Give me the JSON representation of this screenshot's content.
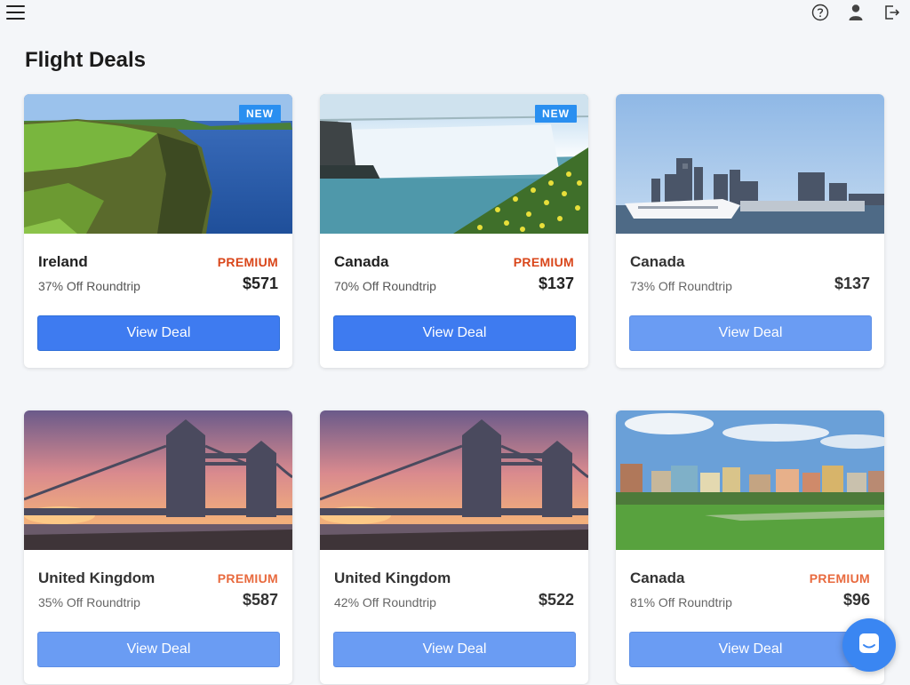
{
  "header": {
    "menu_icon": "hamburger-menu-icon",
    "icons": [
      "help-circle-icon",
      "user-icon",
      "logout-icon"
    ]
  },
  "page": {
    "title": "Flight Deals"
  },
  "colors": {
    "primary_button": "#3e7bf0",
    "premium": "#e35b2b",
    "new_badge": "#2a8ff0"
  },
  "deals": [
    {
      "destination": "Ireland",
      "premium": "PREMIUM",
      "discount": "37% Off Roundtrip",
      "price": "$571",
      "button": "View Deal",
      "badge": "NEW",
      "image": "cliffs-coast-photo"
    },
    {
      "destination": "Canada",
      "premium": "PREMIUM",
      "discount": "70% Off Roundtrip",
      "price": "$137",
      "button": "View Deal",
      "badge": "NEW",
      "image": "waterfall-photo"
    },
    {
      "destination": "Canada",
      "premium": "",
      "discount": "73% Off Roundtrip",
      "price": "$137",
      "button": "View Deal",
      "badge": "",
      "image": "harbor-city-photo"
    },
    {
      "destination": "United Kingdom",
      "premium": "PREMIUM",
      "discount": "35% Off Roundtrip",
      "price": "$587",
      "button": "View Deal",
      "badge": "",
      "image": "tower-bridge-photo"
    },
    {
      "destination": "United Kingdom",
      "premium": "",
      "discount": "42% Off Roundtrip",
      "price": "$522",
      "button": "View Deal",
      "badge": "",
      "image": "tower-bridge-photo"
    },
    {
      "destination": "Canada",
      "premium": "PREMIUM",
      "discount": "81% Off Roundtrip",
      "price": "$96",
      "button": "View Deal",
      "badge": "",
      "image": "city-park-photo"
    }
  ],
  "chat": {
    "icon": "chat-bubble-icon"
  }
}
